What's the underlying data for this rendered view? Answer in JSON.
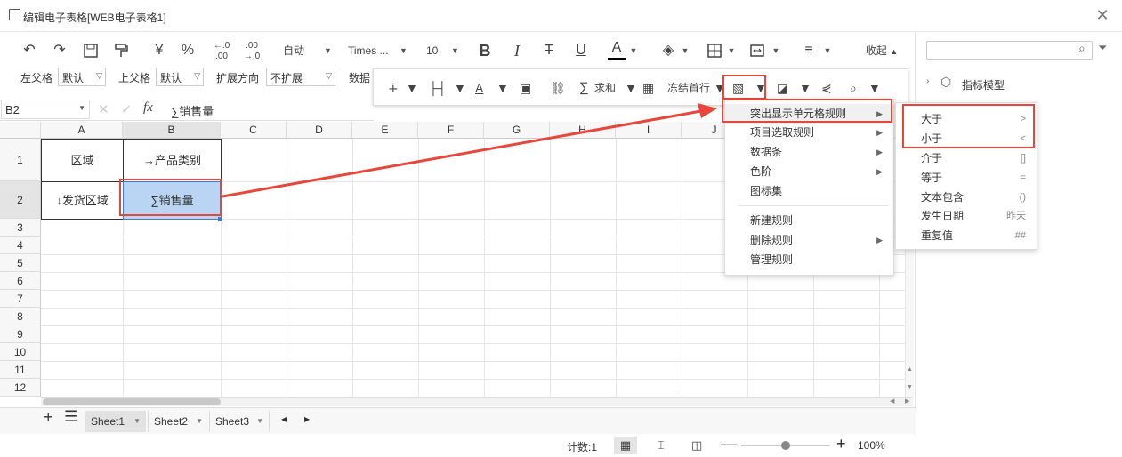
{
  "window": {
    "title": "编辑电子表格[WEB电子表格1]"
  },
  "toolbar1": {
    "format_auto": "自动",
    "font_name": "Times ...",
    "font_size": "10",
    "collapse_label": "收起"
  },
  "toolbar2": {
    "left_parent_label": "左父格",
    "left_parent_value": "默认",
    "top_parent_label": "上父格",
    "top_parent_value": "默认",
    "expand_dir_label": "扩展方向",
    "expand_dir_value": "不扩展",
    "data_label": "数据"
  },
  "floatbar": {
    "sum_label": "求和",
    "freeze_label": "冻结首行"
  },
  "formula": {
    "cell_ref": "B2",
    "fx_label": "fx",
    "content": "∑销售量"
  },
  "grid": {
    "columns": [
      "A",
      "B",
      "C",
      "D",
      "E",
      "F",
      "G",
      "H",
      "I",
      "J"
    ],
    "rows": [
      "1",
      "2",
      "3",
      "4",
      "5",
      "6",
      "7",
      "8",
      "9",
      "10",
      "11",
      "12"
    ],
    "cells": {
      "A1": "区域",
      "B1": "→产品类别",
      "A2": "↓发货区域",
      "B2": "∑销售量"
    }
  },
  "context_menu": {
    "items": [
      {
        "label": "突出显示单元格规则",
        "has_sub": true
      },
      {
        "label": "项目选取规则",
        "has_sub": true
      },
      {
        "label": "数据条",
        "has_sub": true
      },
      {
        "label": "色阶",
        "has_sub": true
      },
      {
        "label": "图标集",
        "has_sub": false
      },
      {
        "label": "新建规则",
        "has_sub": false
      },
      {
        "label": "删除规则",
        "has_sub": true
      },
      {
        "label": "管理规则",
        "has_sub": false
      }
    ]
  },
  "submenu": {
    "items": [
      {
        "label": "大于",
        "shortcut": ">"
      },
      {
        "label": "小于",
        "shortcut": "<"
      },
      {
        "label": "介于",
        "shortcut": "[]"
      },
      {
        "label": "等于",
        "shortcut": "="
      },
      {
        "label": "文本包含",
        "shortcut": "()"
      },
      {
        "label": "发生日期",
        "shortcut": "昨天"
      },
      {
        "label": "重复值",
        "shortcut": "##"
      }
    ]
  },
  "sheets": {
    "tabs": [
      "Sheet1",
      "Sheet2",
      "Sheet3"
    ],
    "active": "Sheet1"
  },
  "status": {
    "count_label": "计数:1",
    "zoom": "100%",
    "zoom_level": 0.5
  },
  "right_panel": {
    "tree_item": "指标模型",
    "search_placeholder": ""
  },
  "colors": {
    "accent_red": "#e8463a",
    "selected_cell": "#b9d5f3",
    "cell_border_blue": "#3a7bd5"
  }
}
